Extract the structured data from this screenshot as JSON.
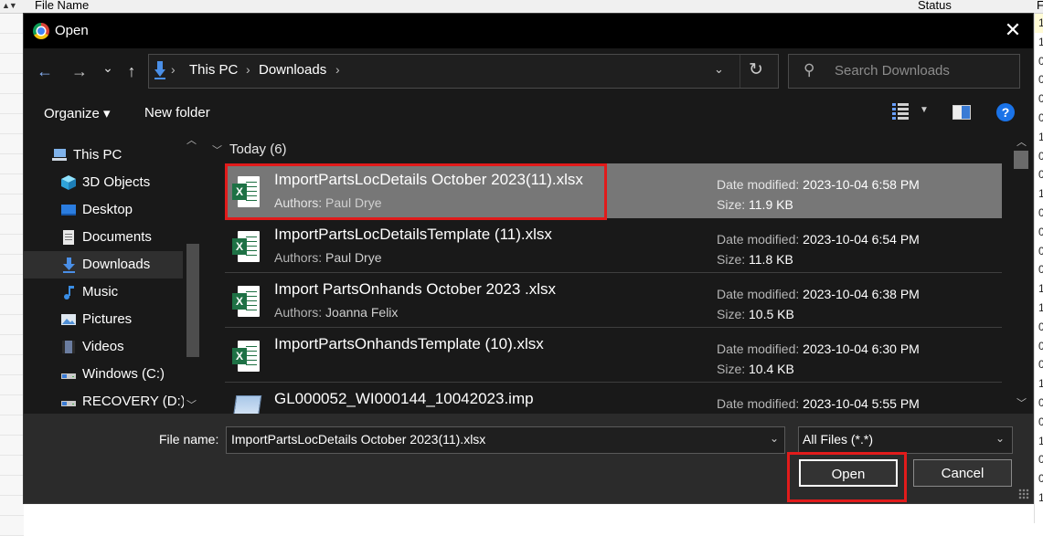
{
  "background": {
    "headers": [
      "File Name",
      "Status",
      "F"
    ],
    "right_digits": [
      "1",
      "1",
      "0",
      "0",
      "0",
      "0",
      "1",
      "0",
      "0",
      "1",
      "0",
      "0",
      "0",
      "0",
      "1",
      "1",
      "0",
      "0",
      "0",
      "1",
      "0",
      "0",
      "1",
      "0",
      "0",
      "1"
    ]
  },
  "dialog": {
    "title": "Open",
    "close": "✕",
    "nav": {
      "back": "←",
      "forward": "→",
      "recent": "⌄",
      "up": "↑",
      "breadcrumb": [
        "This PC",
        "Downloads"
      ],
      "separator": "›",
      "address_dropdown": "⌄",
      "refresh": "↻",
      "search_placeholder": "Search Downloads",
      "search_icon": "⚲"
    },
    "toolbar": {
      "organize": "Organize ▾",
      "new_folder": "New folder",
      "view_dropdown": "▼",
      "help": "?"
    },
    "sidebar": {
      "items": [
        {
          "label": "This PC",
          "icon": "computer-icon"
        },
        {
          "label": "3D Objects",
          "icon": "cube-icon"
        },
        {
          "label": "Desktop",
          "icon": "desktop-icon"
        },
        {
          "label": "Documents",
          "icon": "documents-icon"
        },
        {
          "label": "Downloads",
          "icon": "download-icon",
          "selected": true
        },
        {
          "label": "Music",
          "icon": "music-icon"
        },
        {
          "label": "Pictures",
          "icon": "pictures-icon"
        },
        {
          "label": "Videos",
          "icon": "videos-icon"
        },
        {
          "label": "Windows (C:)",
          "icon": "drive-icon"
        },
        {
          "label": "RECOVERY (D:)",
          "icon": "drive-icon"
        }
      ]
    },
    "filelist": {
      "group": "Today (6)",
      "date_key": "Date modified:",
      "size_key": "Size:",
      "authors_key": "Authors:",
      "files": [
        {
          "name": "ImportPartsLocDetails October 2023(11).xlsx",
          "authors": "Paul Drye",
          "date": "2023-10-04 6:58 PM",
          "size": "11.9 KB",
          "selected": true,
          "type": "excel"
        },
        {
          "name": "ImportPartsLocDetailsTemplate (11).xlsx",
          "authors": "Paul Drye",
          "date": "2023-10-04 6:54 PM",
          "size": "11.8 KB",
          "type": "excel"
        },
        {
          "name": "Import PartsOnhands October 2023 .xlsx",
          "authors": "Joanna Felix",
          "date": "2023-10-04 6:38 PM",
          "size": "10.5 KB",
          "type": "excel"
        },
        {
          "name": "ImportPartsOnhandsTemplate (10).xlsx",
          "authors": "",
          "date": "2023-10-04 6:30 PM",
          "size": "10.4 KB",
          "type": "excel"
        },
        {
          "name": "GL000052_WI000144_10042023.imp",
          "authors": "",
          "date": "2023-10-04 5:55 PM",
          "size": "",
          "type": "imp"
        }
      ]
    },
    "footer": {
      "file_name_label": "File name:",
      "file_name_value": "ImportPartsLocDetails October 2023(11).xlsx",
      "filter_value": "All Files (*.*)",
      "dropdown": "⌄",
      "open": "Open",
      "cancel": "Cancel"
    }
  }
}
